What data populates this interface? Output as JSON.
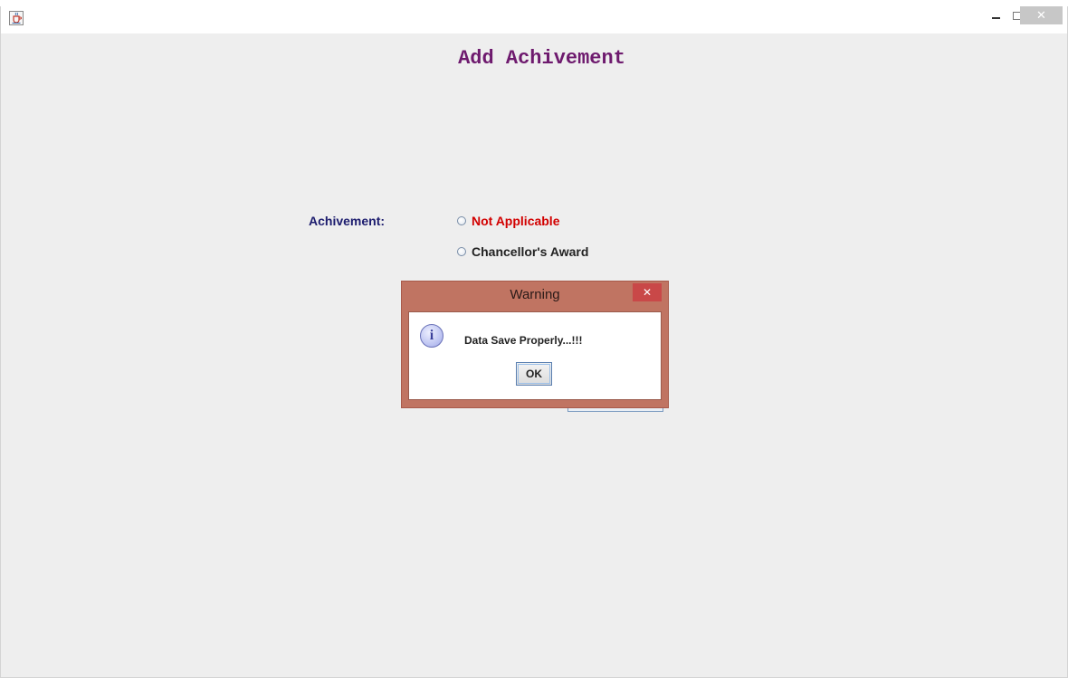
{
  "window": {
    "title_icon": "java-cup-icon",
    "controls": {
      "minimize": "minimize-icon",
      "maximize": "maximize-icon",
      "close": "✕"
    }
  },
  "form": {
    "title": "Add Achivement",
    "achievement_label": "Achivement:",
    "options": [
      {
        "label": "Not Applicable",
        "color": "#d20000"
      },
      {
        "label": "Chancellor's Award",
        "color": "#222222"
      }
    ]
  },
  "dialog": {
    "title": "Warning",
    "close": "✕",
    "icon": "info-icon",
    "icon_glyph": "i",
    "message": "Data Save Properly...!!!",
    "ok_label": "OK"
  },
  "colors": {
    "title": "#6e1a6e",
    "label": "#1c1c6e",
    "dialog_frame": "#c07462",
    "dialog_close": "#c94848"
  }
}
